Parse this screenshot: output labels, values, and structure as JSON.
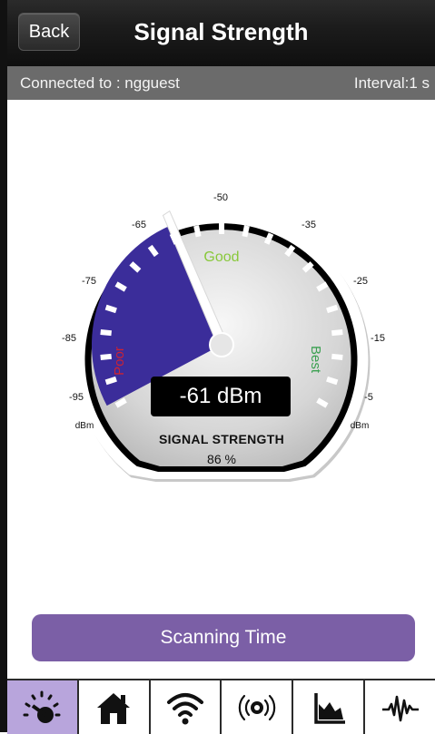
{
  "header": {
    "back_label": "Back",
    "title": "Signal Strength"
  },
  "status": {
    "connected_label": "Connected to : ngguest",
    "interval_label": "Interval:1 s"
  },
  "gauge": {
    "scale_labels": [
      "-95",
      "-85",
      "-75",
      "-65",
      "-50",
      "-35",
      "-25",
      "-15",
      "-5"
    ],
    "unit_left": "dBm",
    "unit_right": "dBm",
    "zone_poor": "Poor",
    "zone_good": "Good",
    "zone_best": "Best",
    "reading": "-61 dBm",
    "caption": "SIGNAL STRENGTH",
    "percent": "86 %",
    "value_dbm": -61,
    "colors": {
      "poor_fill": "#3b2d9a",
      "poor_text": "#cc2233",
      "good_text": "#88c83a",
      "best_text": "#3aa050"
    }
  },
  "actions": {
    "scan_label": "Scanning Time"
  },
  "tabs": [
    {
      "icon": "signal-gauge-icon",
      "active": true
    },
    {
      "icon": "home-icon",
      "active": false
    },
    {
      "icon": "wifi-icon",
      "active": false
    },
    {
      "icon": "radar-icon",
      "active": false
    },
    {
      "icon": "area-chart-icon",
      "active": false
    },
    {
      "icon": "waveform-icon",
      "active": false
    }
  ]
}
